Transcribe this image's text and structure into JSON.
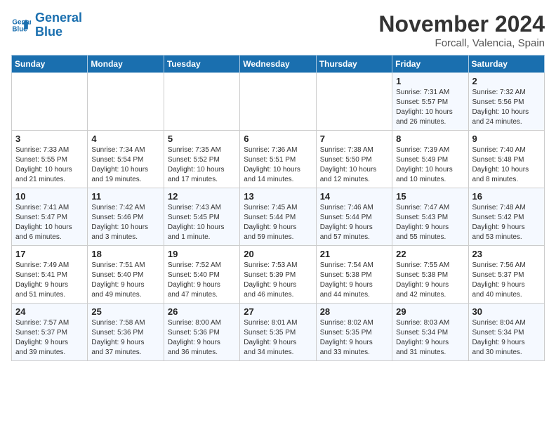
{
  "logo": {
    "line1": "General",
    "line2": "Blue"
  },
  "title": "November 2024",
  "location": "Forcall, Valencia, Spain",
  "weekdays": [
    "Sunday",
    "Monday",
    "Tuesday",
    "Wednesday",
    "Thursday",
    "Friday",
    "Saturday"
  ],
  "weeks": [
    [
      {
        "day": "",
        "info": ""
      },
      {
        "day": "",
        "info": ""
      },
      {
        "day": "",
        "info": ""
      },
      {
        "day": "",
        "info": ""
      },
      {
        "day": "",
        "info": ""
      },
      {
        "day": "1",
        "info": "Sunrise: 7:31 AM\nSunset: 5:57 PM\nDaylight: 10 hours\nand 26 minutes."
      },
      {
        "day": "2",
        "info": "Sunrise: 7:32 AM\nSunset: 5:56 PM\nDaylight: 10 hours\nand 24 minutes."
      }
    ],
    [
      {
        "day": "3",
        "info": "Sunrise: 7:33 AM\nSunset: 5:55 PM\nDaylight: 10 hours\nand 21 minutes."
      },
      {
        "day": "4",
        "info": "Sunrise: 7:34 AM\nSunset: 5:54 PM\nDaylight: 10 hours\nand 19 minutes."
      },
      {
        "day": "5",
        "info": "Sunrise: 7:35 AM\nSunset: 5:52 PM\nDaylight: 10 hours\nand 17 minutes."
      },
      {
        "day": "6",
        "info": "Sunrise: 7:36 AM\nSunset: 5:51 PM\nDaylight: 10 hours\nand 14 minutes."
      },
      {
        "day": "7",
        "info": "Sunrise: 7:38 AM\nSunset: 5:50 PM\nDaylight: 10 hours\nand 12 minutes."
      },
      {
        "day": "8",
        "info": "Sunrise: 7:39 AM\nSunset: 5:49 PM\nDaylight: 10 hours\nand 10 minutes."
      },
      {
        "day": "9",
        "info": "Sunrise: 7:40 AM\nSunset: 5:48 PM\nDaylight: 10 hours\nand 8 minutes."
      }
    ],
    [
      {
        "day": "10",
        "info": "Sunrise: 7:41 AM\nSunset: 5:47 PM\nDaylight: 10 hours\nand 6 minutes."
      },
      {
        "day": "11",
        "info": "Sunrise: 7:42 AM\nSunset: 5:46 PM\nDaylight: 10 hours\nand 3 minutes."
      },
      {
        "day": "12",
        "info": "Sunrise: 7:43 AM\nSunset: 5:45 PM\nDaylight: 10 hours\nand 1 minute."
      },
      {
        "day": "13",
        "info": "Sunrise: 7:45 AM\nSunset: 5:44 PM\nDaylight: 9 hours\nand 59 minutes."
      },
      {
        "day": "14",
        "info": "Sunrise: 7:46 AM\nSunset: 5:44 PM\nDaylight: 9 hours\nand 57 minutes."
      },
      {
        "day": "15",
        "info": "Sunrise: 7:47 AM\nSunset: 5:43 PM\nDaylight: 9 hours\nand 55 minutes."
      },
      {
        "day": "16",
        "info": "Sunrise: 7:48 AM\nSunset: 5:42 PM\nDaylight: 9 hours\nand 53 minutes."
      }
    ],
    [
      {
        "day": "17",
        "info": "Sunrise: 7:49 AM\nSunset: 5:41 PM\nDaylight: 9 hours\nand 51 minutes."
      },
      {
        "day": "18",
        "info": "Sunrise: 7:51 AM\nSunset: 5:40 PM\nDaylight: 9 hours\nand 49 minutes."
      },
      {
        "day": "19",
        "info": "Sunrise: 7:52 AM\nSunset: 5:40 PM\nDaylight: 9 hours\nand 47 minutes."
      },
      {
        "day": "20",
        "info": "Sunrise: 7:53 AM\nSunset: 5:39 PM\nDaylight: 9 hours\nand 46 minutes."
      },
      {
        "day": "21",
        "info": "Sunrise: 7:54 AM\nSunset: 5:38 PM\nDaylight: 9 hours\nand 44 minutes."
      },
      {
        "day": "22",
        "info": "Sunrise: 7:55 AM\nSunset: 5:38 PM\nDaylight: 9 hours\nand 42 minutes."
      },
      {
        "day": "23",
        "info": "Sunrise: 7:56 AM\nSunset: 5:37 PM\nDaylight: 9 hours\nand 40 minutes."
      }
    ],
    [
      {
        "day": "24",
        "info": "Sunrise: 7:57 AM\nSunset: 5:37 PM\nDaylight: 9 hours\nand 39 minutes."
      },
      {
        "day": "25",
        "info": "Sunrise: 7:58 AM\nSunset: 5:36 PM\nDaylight: 9 hours\nand 37 minutes."
      },
      {
        "day": "26",
        "info": "Sunrise: 8:00 AM\nSunset: 5:36 PM\nDaylight: 9 hours\nand 36 minutes."
      },
      {
        "day": "27",
        "info": "Sunrise: 8:01 AM\nSunset: 5:35 PM\nDaylight: 9 hours\nand 34 minutes."
      },
      {
        "day": "28",
        "info": "Sunrise: 8:02 AM\nSunset: 5:35 PM\nDaylight: 9 hours\nand 33 minutes."
      },
      {
        "day": "29",
        "info": "Sunrise: 8:03 AM\nSunset: 5:34 PM\nDaylight: 9 hours\nand 31 minutes."
      },
      {
        "day": "30",
        "info": "Sunrise: 8:04 AM\nSunset: 5:34 PM\nDaylight: 9 hours\nand 30 minutes."
      }
    ]
  ]
}
